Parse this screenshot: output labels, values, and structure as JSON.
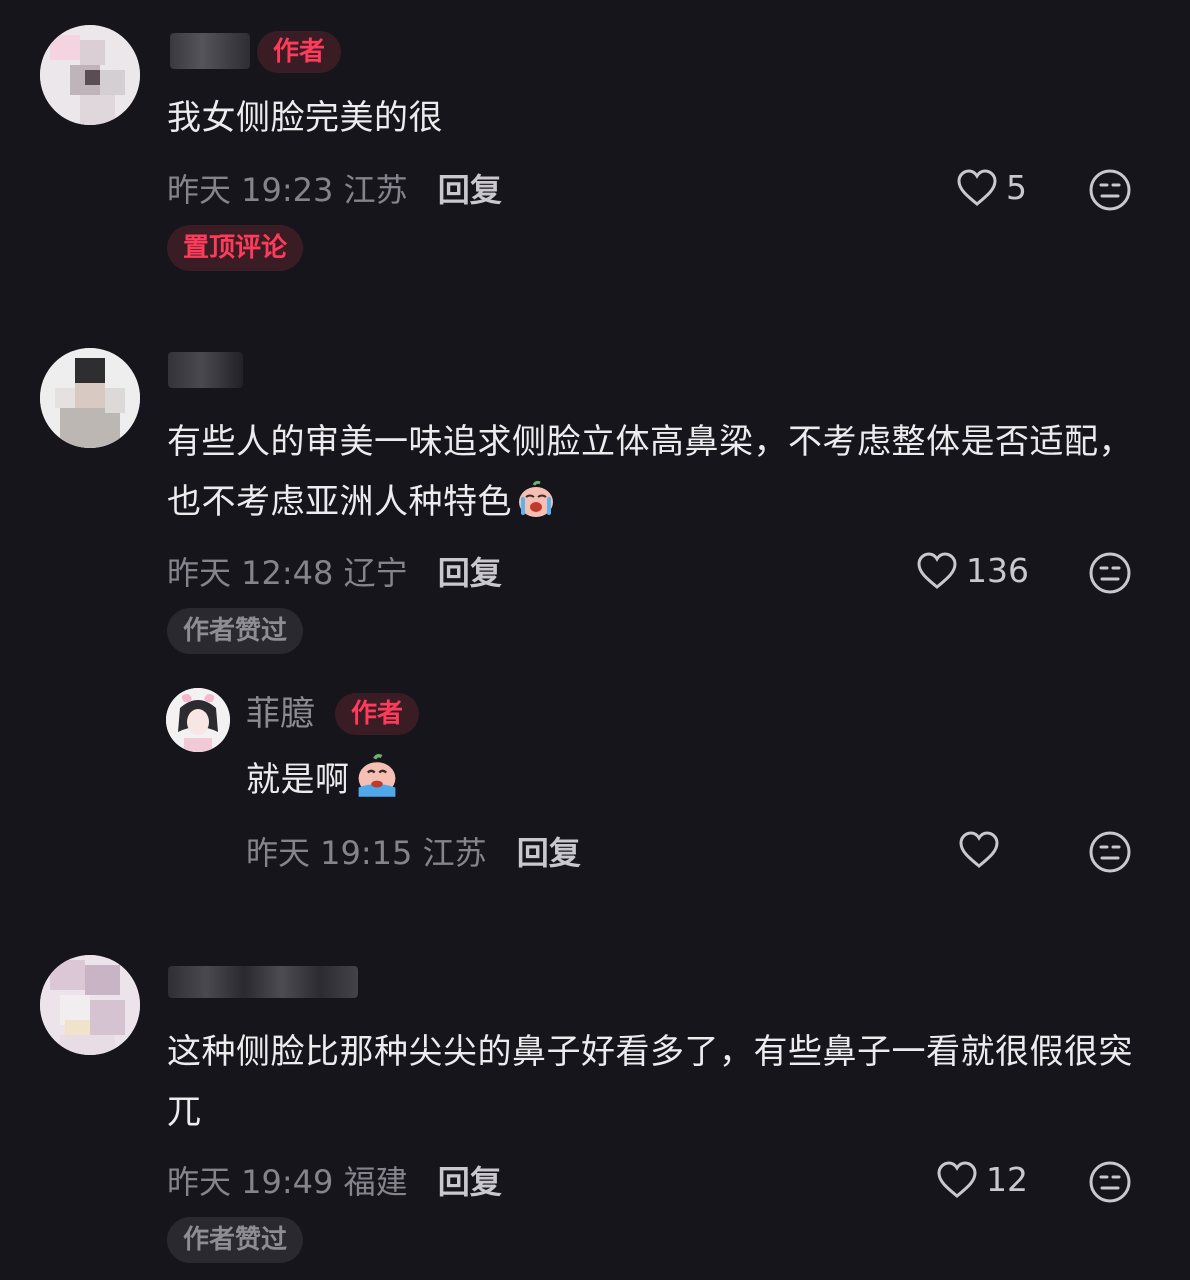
{
  "comments": [
    {
      "author_tag": "作者",
      "text": "我女侧脸完美的很",
      "time": "昨天 19:23",
      "location": "江苏",
      "reply_label": "回复",
      "likes": "5",
      "badge": "置顶评论"
    },
    {
      "text": "有些人的审美一味追求侧脸立体高鼻梁，不考虑整体是否适配，也不考虑亚洲人种特色",
      "time": "昨天 12:48",
      "location": "辽宁",
      "reply_label": "回复",
      "likes": "136",
      "badge": "作者赞过",
      "reply": {
        "name": "菲臆",
        "author_tag": "作者",
        "text": "就是啊",
        "time": "昨天 19:15",
        "location": "江苏",
        "reply_label": "回复"
      }
    },
    {
      "text": "这种侧脸比那种尖尖的鼻子好看多了，有些鼻子一看就很假很突兀",
      "time": "昨天 19:49",
      "location": "福建",
      "reply_label": "回复",
      "likes": "12",
      "badge": "作者赞过"
    }
  ],
  "colors": {
    "background": "#16151b",
    "accent_red": "#ff3b5c",
    "meta_gray": "#85848c"
  },
  "icons": [
    "heart-icon",
    "neutral-face-icon",
    "crying-emoji-icon"
  ]
}
